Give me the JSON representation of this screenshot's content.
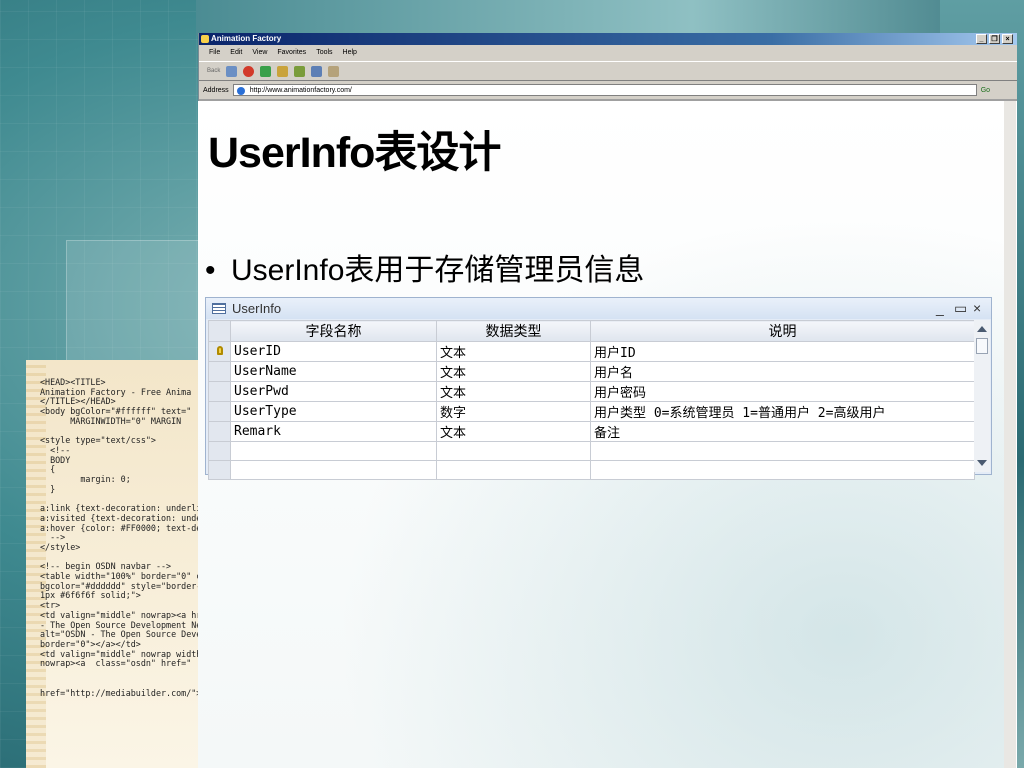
{
  "browser": {
    "title": "Animation Factory",
    "window_buttons": [
      "_",
      "❐",
      "×"
    ],
    "menu": [
      "File",
      "Edit",
      "View",
      "Favorites",
      "Tools",
      "Help"
    ],
    "toolbar_back": "Back",
    "address_label": "Address",
    "address_value": "http://www.animationfactory.com/",
    "go_label": "Go"
  },
  "slide": {
    "title": "UserInfo表设计",
    "bullet_marker": "•",
    "bullet_text": "UserInfo表用于存储管理员信息"
  },
  "table_window": {
    "title": "UserInfo",
    "controls": [
      "_",
      "▭",
      "×"
    ],
    "columns": [
      "字段名称",
      "数据类型",
      "说明"
    ],
    "rows": [
      {
        "key": true,
        "name": "UserID",
        "type": "文本",
        "desc": "用户ID"
      },
      {
        "key": false,
        "name": "UserName",
        "type": "文本",
        "desc": "用户名"
      },
      {
        "key": false,
        "name": "UserPwd",
        "type": "文本",
        "desc": "用户密码"
      },
      {
        "key": false,
        "name": "UserType",
        "type": "数字",
        "desc": "用户类型 0=系统管理员 1=普通用户 2=高级用户"
      },
      {
        "key": false,
        "name": "Remark",
        "type": "文本",
        "desc": "备注"
      },
      {
        "key": false,
        "name": "",
        "type": "",
        "desc": ""
      },
      {
        "key": false,
        "name": "",
        "type": "",
        "desc": ""
      }
    ]
  },
  "code_listing": "<HEAD><TITLE>\nAnimation Factory - Free Anima\n</TITLE></HEAD>\n<body bgColor=\"#ffffff\" text=\"\n      MARGINWIDTH=\"0\" MARGIN\n\n<style type=\"text/css\">\n  <!--\n  BODY\n  {\n        margin: 0;\n  }\n\na:link {text-decoration: underline}\na:visited {text-decoration: underline}\na:hover {color: #FF0000; text-decoration: no\n  -->\n</style>\n\n<!-- begin OSDN navbar -->\n<table width=\"100%\" border=\"0\" cellpadding=\"\nbgcolor=\"#dddddd\" style=\"border-top: 1px #6f6\n1px #6f6f6f solid;\">\n<tr>\n<td valign=\"middle\" nowrap><a href=\"http://\n- The Open Source Development Network\" b\nalt=\"OSDN - The Open Source Development Netw\nborder=\"0\"></a></td>\n<td valign=\"middle\" nowrap width=\"100%\"\nnowrap><a  class=\"osdn\" href=\"\n\n\nhref=\"http://mediabuilder.com/\">Cooltext<a>\n"
}
